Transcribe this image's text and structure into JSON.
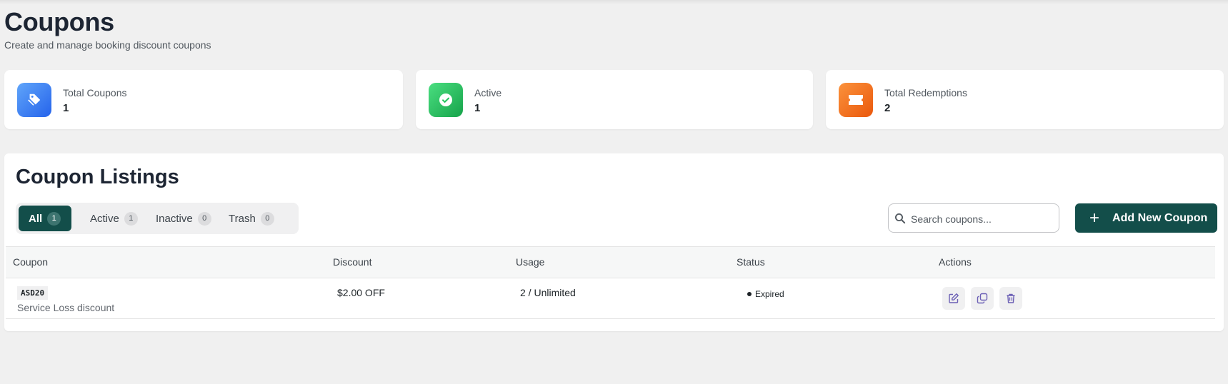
{
  "page": {
    "title": "Coupons",
    "subtitle": "Create and manage booking discount coupons"
  },
  "stats": [
    {
      "label": "Total Coupons",
      "value": "1",
      "icon": "tags-icon",
      "color": "#3b82f6"
    },
    {
      "label": "Active",
      "value": "1",
      "icon": "check-circle-icon",
      "color": "#22c55e"
    },
    {
      "label": "Total Redemptions",
      "value": "2",
      "icon": "ticket-icon",
      "color": "#f97316"
    }
  ],
  "listings": {
    "title": "Coupon Listings",
    "tabs": [
      {
        "label": "All",
        "count": "1",
        "active": true
      },
      {
        "label": "Active",
        "count": "1",
        "active": false
      },
      {
        "label": "Inactive",
        "count": "0",
        "active": false
      },
      {
        "label": "Trash",
        "count": "0",
        "active": false
      }
    ],
    "search_placeholder": "Search coupons...",
    "add_button": "Add New Coupon",
    "add_button_icon": "plus-icon",
    "accent_color": "#134e4a",
    "columns": [
      "Coupon",
      "Discount",
      "Usage",
      "Status",
      "Actions"
    ],
    "rows": [
      {
        "code": "ASD20",
        "description": "Service Loss discount",
        "discount": "$2.00 OFF",
        "usage": "2 / Unlimited",
        "status": "Expired",
        "actions": [
          "edit-icon",
          "duplicate-icon",
          "trash-icon"
        ]
      }
    ]
  }
}
